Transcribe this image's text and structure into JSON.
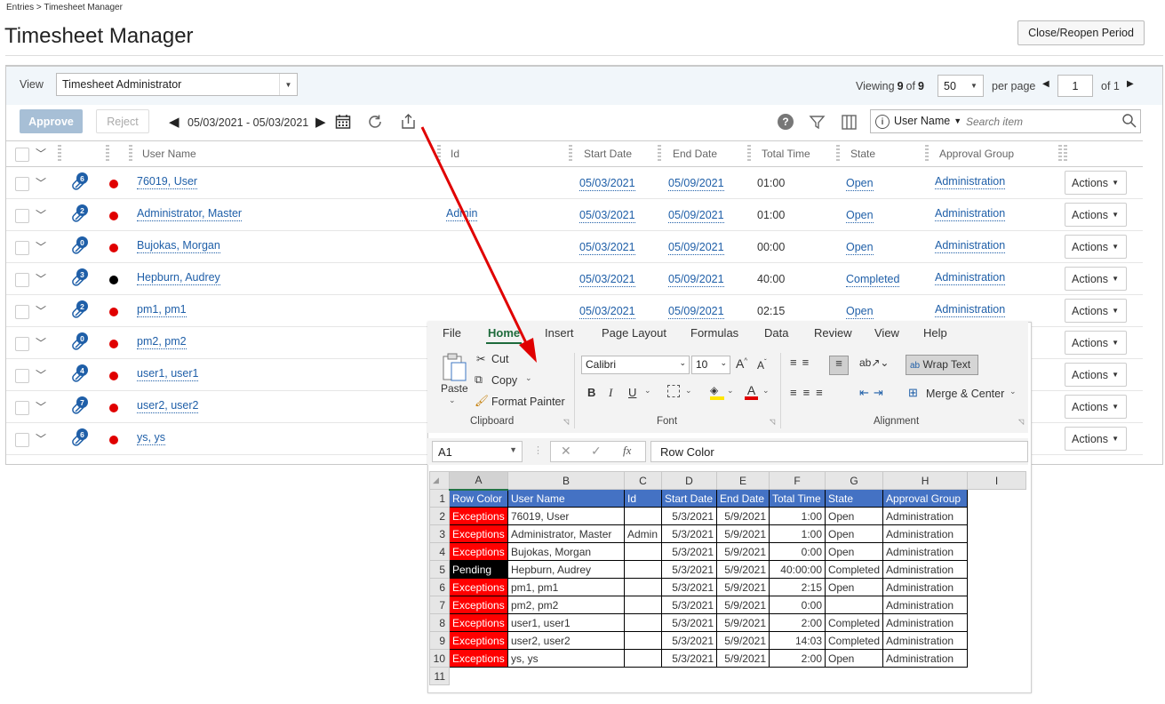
{
  "breadcrumb": "Entries > Timesheet Manager",
  "page_title": "Timesheet Manager",
  "close_reopen": "Close/Reopen Period",
  "view": {
    "label": "View",
    "value": "Timesheet Administrator"
  },
  "paging": {
    "viewing_label": "Viewing",
    "viewing_count": "9",
    "of": "of",
    "total": "9",
    "per_page_value": "50",
    "per_page_label": "per page",
    "page": "1",
    "of_pages": "of 1"
  },
  "toolbar": {
    "approve": "Approve",
    "reject": "Reject",
    "date_range": "05/03/2021 - 05/03/2021",
    "search_field": "User Name",
    "search_placeholder": "Search item"
  },
  "columns": [
    "User Name",
    "Id",
    "Start Date",
    "End Date",
    "Total Time",
    "State",
    "Approval Group"
  ],
  "rows": [
    {
      "badge": "6",
      "dot": "#e00000",
      "user": "76019, User",
      "id": "",
      "start": "05/03/2021",
      "end": "05/09/2021",
      "total": "01:00",
      "state": "Open",
      "group": "Administration"
    },
    {
      "badge": "2",
      "dot": "#e00000",
      "user": "Administrator, Master",
      "id": "Admin",
      "start": "05/03/2021",
      "end": "05/09/2021",
      "total": "01:00",
      "state": "Open",
      "group": "Administration"
    },
    {
      "badge": "0",
      "dot": "#e00000",
      "user": "Bujokas, Morgan",
      "id": "",
      "start": "05/03/2021",
      "end": "05/09/2021",
      "total": "00:00",
      "state": "Open",
      "group": "Administration"
    },
    {
      "badge": "3",
      "dot": "#000000",
      "user": "Hepburn, Audrey",
      "id": "",
      "start": "05/03/2021",
      "end": "05/09/2021",
      "total": "40:00",
      "state": "Completed",
      "group": "Administration"
    },
    {
      "badge": "2",
      "dot": "#e00000",
      "user": "pm1, pm1",
      "id": "",
      "start": "05/03/2021",
      "end": "05/09/2021",
      "total": "02:15",
      "state": "Open",
      "group": "Administration"
    },
    {
      "badge": "0",
      "dot": "#e00000",
      "user": "pm2, pm2",
      "id": "",
      "start": "",
      "end": "",
      "total": "",
      "state": "",
      "group": ""
    },
    {
      "badge": "4",
      "dot": "#e00000",
      "user": "user1, user1",
      "id": "",
      "start": "",
      "end": "",
      "total": "",
      "state": "",
      "group": ""
    },
    {
      "badge": "7",
      "dot": "#e00000",
      "user": "user2, user2",
      "id": "",
      "start": "",
      "end": "",
      "total": "",
      "state": "",
      "group": ""
    },
    {
      "badge": "6",
      "dot": "#e00000",
      "user": "ys, ys",
      "id": "",
      "start": "",
      "end": "",
      "total": "",
      "state": "",
      "group": ""
    }
  ],
  "actions_label": "Actions",
  "excel": {
    "tabs": [
      "File",
      "Home",
      "Insert",
      "Page Layout",
      "Formulas",
      "Data",
      "Review",
      "View",
      "Help"
    ],
    "clipboard": {
      "paste": "Paste",
      "cut": "Cut",
      "copy": "Copy",
      "format_painter": "Format Painter",
      "group": "Clipboard"
    },
    "font": {
      "name": "Calibri",
      "size": "10",
      "group": "Font"
    },
    "alignment": {
      "wrap": "Wrap Text",
      "merge": "Merge & Center",
      "group": "Alignment"
    },
    "name_box": "A1",
    "formula": "Row Color",
    "col_letters": [
      "A",
      "B",
      "C",
      "D",
      "E",
      "F",
      "G",
      "H",
      "I"
    ],
    "header": [
      "Row Color",
      "User Name",
      "Id",
      "Start Date",
      "End Date",
      "Total Time",
      "State",
      "Approval Group"
    ],
    "rows": [
      [
        "Exceptions",
        "76019, User",
        "",
        "5/3/2021",
        "5/9/2021",
        "1:00",
        "Open",
        "Administration"
      ],
      [
        "Exceptions",
        "Administrator, Master",
        "Admin",
        "5/3/2021",
        "5/9/2021",
        "1:00",
        "Open",
        "Administration"
      ],
      [
        "Exceptions",
        "Bujokas, Morgan",
        "",
        "5/3/2021",
        "5/9/2021",
        "0:00",
        "Open",
        "Administration"
      ],
      [
        "Pending",
        "Hepburn, Audrey",
        "",
        "5/3/2021",
        "5/9/2021",
        "40:00:00",
        "Completed",
        "Administration"
      ],
      [
        "Exceptions",
        "pm1, pm1",
        "",
        "5/3/2021",
        "5/9/2021",
        "2:15",
        "Open",
        "Administration"
      ],
      [
        "Exceptions",
        "pm2, pm2",
        "",
        "5/3/2021",
        "5/9/2021",
        "0:00",
        "",
        "Administration"
      ],
      [
        "Exceptions",
        "user1, user1",
        "",
        "5/3/2021",
        "5/9/2021",
        "2:00",
        "Completed",
        "Administration"
      ],
      [
        "Exceptions",
        "user2, user2",
        "",
        "5/3/2021",
        "5/9/2021",
        "14:03",
        "Completed",
        "Administration"
      ],
      [
        "Exceptions",
        "ys, ys",
        "",
        "5/3/2021",
        "5/9/2021",
        "2:00",
        "Open",
        "Administration"
      ]
    ]
  },
  "colors": {
    "link": "#1f5fa8",
    "exception": "#ff0000",
    "pending": "#000000",
    "header_blue": "#4472c4",
    "arrow": "#e00000"
  }
}
